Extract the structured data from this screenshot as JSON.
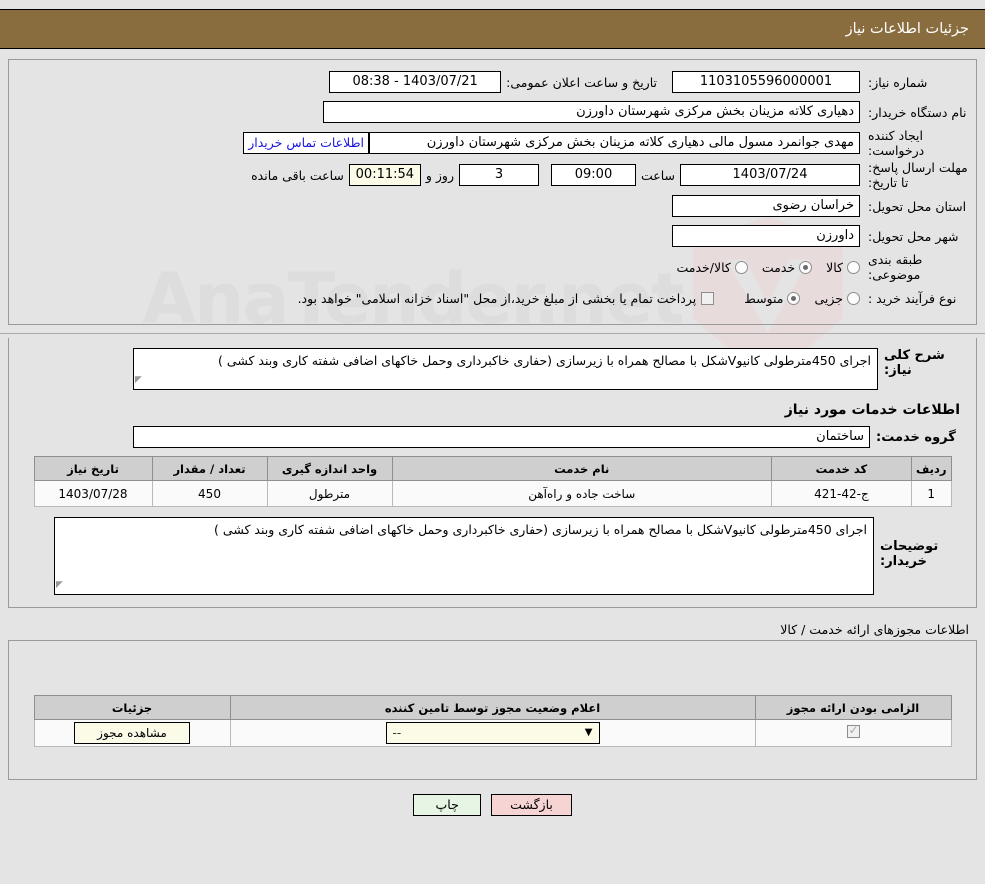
{
  "header": {
    "title": "جزئیات اطلاعات نیاز"
  },
  "watermark": {
    "text": "AnaTender.net"
  },
  "form": {
    "need_number_label": "شماره نیاز:",
    "need_number_value": "1103105596000001",
    "announce_label": "تاریخ و ساعت اعلان عمومی:",
    "announce_value": "1403/07/21 - 08:38",
    "buyer_org_label": "نام دستگاه خریدار:",
    "buyer_org_value": "دهیاری کلاته مزینان بخش مرکزی شهرستان داورزن",
    "creator_label": "ایجاد کننده درخواست:",
    "creator_value": "مهدی جوانمرد مسول مالی دهیاری کلاته مزینان بخش مرکزی شهرستان داورزن",
    "contact_link": "اطلاعات تماس خریدار",
    "deadline_label": "مهلت ارسال پاسخ: تا تاریخ:",
    "deadline_date": "1403/07/24",
    "deadline_time_label": "ساعت",
    "deadline_time": "09:00",
    "days_value": "3",
    "days_and_label": "روز و",
    "countdown_value": "00:11:54",
    "remaining_label": "ساعت باقی مانده",
    "province_label": "استان محل تحویل:",
    "province_value": "خراسان رضوی",
    "city_label": "شهر محل تحویل:",
    "city_value": "داورزن",
    "category_label": "طبقه بندی موضوعی:",
    "category_options": [
      {
        "label": "کالا",
        "selected": false
      },
      {
        "label": "خدمت",
        "selected": true
      },
      {
        "label": "کالا/خدمت",
        "selected": false
      }
    ],
    "purchase_label": "نوع فرآیند خرید :",
    "purchase_options": [
      {
        "label": "جزیی",
        "selected": false
      },
      {
        "label": "متوسط",
        "selected": true
      }
    ],
    "treasury_checkbox_checked": false,
    "treasury_text": "پرداخت تمام یا بخشی از مبلغ خرید،از محل \"اسناد خزانه اسلامی\" خواهد بود."
  },
  "description": {
    "label": "شرح کلی نیاز:",
    "value": "اجرای 450مترطولی کانیوVشکل با مصالح همراه با زیرسازی (حفاری خاکبرداری وحمل خاکهای اضافی  شفته کاری وبند کشی )"
  },
  "services": {
    "heading": "اطلاعات خدمات مورد نیاز",
    "group_label": "گروه خدمت:",
    "group_value": "ساختمان",
    "columns": [
      "ردیف",
      "کد خدمت",
      "نام خدمت",
      "واحد اندازه گیری",
      "تعداد / مقدار",
      "تاریخ نیاز"
    ],
    "rows": [
      {
        "index": "1",
        "code": "ج-42-421",
        "name": "ساخت جاده و راه‌آهن",
        "unit": "مترطول",
        "quantity": "450",
        "date": "1403/07/28"
      }
    ]
  },
  "buyer_notes": {
    "label": "توضیحات خریدار:",
    "value": "اجرای 450مترطولی کانیوVشکل با مصالح همراه با زیرسازی (حفاری خاکبرداری وحمل خاکهای اضافی  شفته کاری وبند کشی )"
  },
  "permits": {
    "title": "اطلاعات مجوزهای ارائه خدمت / کالا",
    "columns": [
      "الزامی بودن ارائه مجوز",
      "اعلام وضعیت مجوز توسط تامین کننده",
      "جزئیات"
    ],
    "rows": [
      {
        "required_checked": true,
        "status_value": "--",
        "detail_button": "مشاهده مجوز"
      }
    ]
  },
  "footer": {
    "print_label": "چاپ",
    "back_label": "بازگشت"
  },
  "colors": {
    "header_bar": "#8a6d3f",
    "link": "#1a14e0",
    "print_button": "#e6f5e4",
    "back_button": "#f7d4d4",
    "highlight_field": "#fbfbe8",
    "table_header": "#cfcfcf"
  }
}
